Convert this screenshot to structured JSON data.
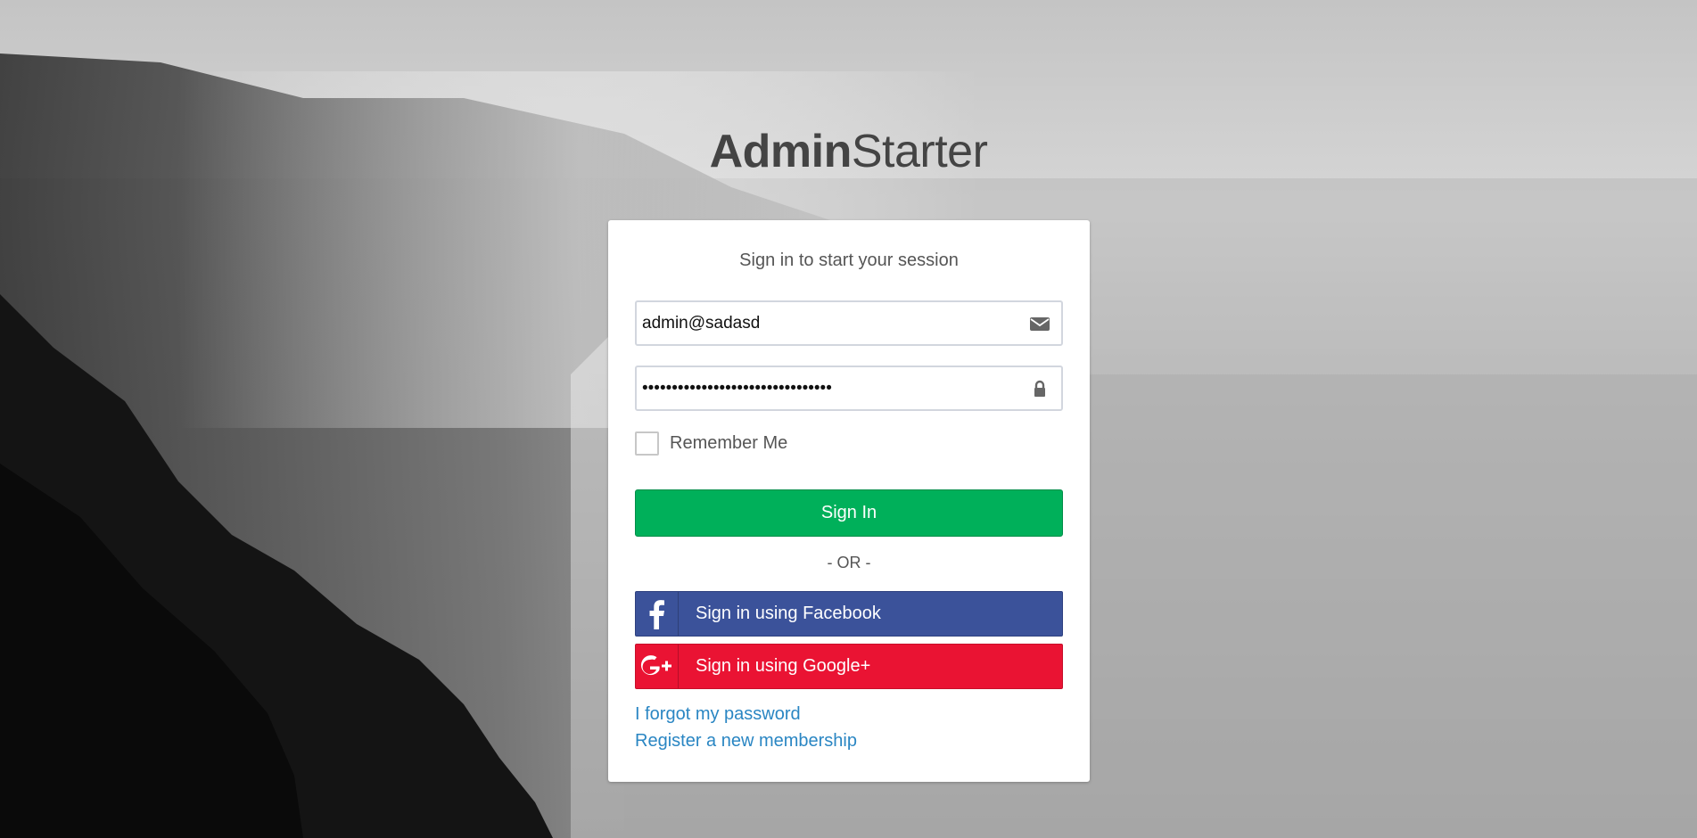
{
  "logo": {
    "bold": "Admin",
    "light": "Starter"
  },
  "login": {
    "message": "Sign in to start your session",
    "email_value": "admin@sadasd",
    "password_value": "********************************",
    "remember_label": "Remember Me",
    "remember_checked": false,
    "signin_label": "Sign In",
    "or_label": "- OR -",
    "facebook_label": "Sign in using Facebook",
    "google_label": "Sign in using Google+",
    "forgot_label": "I forgot my password",
    "register_label": "Register a new membership"
  },
  "icons": {
    "email": "envelope-icon",
    "password": "lock-icon",
    "facebook": "facebook-icon",
    "google": "google-plus-icon"
  },
  "colors": {
    "signin": "#00b05a",
    "facebook": "#3b529a",
    "google": "#ea1333",
    "link": "#2a86c3"
  }
}
